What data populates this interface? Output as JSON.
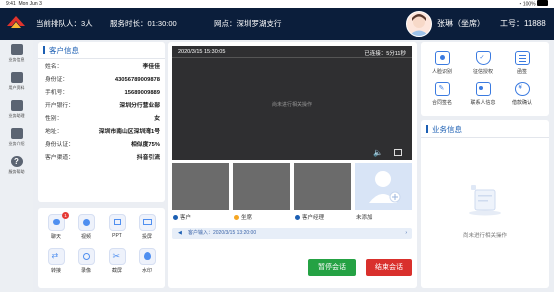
{
  "status_bar": {
    "time": "9:41",
    "date": "Mon Jun 3",
    "battery": "100%"
  },
  "top_bar": {
    "queue": "当前排队人：3人",
    "duration": "服务时长：01:30:00",
    "branch": "网点：深圳罗湖支行",
    "agent_name": "张琳（坐席）",
    "employee_id": "工号：11888"
  },
  "sidebar": {
    "items": [
      {
        "label": "业务信息",
        "icon": "grid-icon"
      },
      {
        "label": "用户资料",
        "icon": "book-icon"
      },
      {
        "label": "业务助理",
        "icon": "assistant-icon"
      },
      {
        "label": "业务介绍",
        "icon": "briefcase-icon"
      },
      {
        "label": "服务帮助",
        "icon": "help-icon"
      }
    ]
  },
  "customer": {
    "title": "客户信息",
    "rows": [
      {
        "key": "姓名：",
        "value": "李佳佳"
      },
      {
        "key": "身份证：",
        "value": "43056789009878"
      },
      {
        "key": "手机号：",
        "value": "15689009889"
      },
      {
        "key": "开户银行：",
        "value": "深圳分行营业部"
      },
      {
        "key": "性别：",
        "value": "女"
      },
      {
        "key": "地址：",
        "value": "深圳市南山区深圳湾1号"
      },
      {
        "key": "身份认证：",
        "value": "相似度75%"
      },
      {
        "key": "客户渠道：",
        "value": "抖音引流"
      }
    ]
  },
  "tools": [
    {
      "label": "聊天",
      "icon": "chat-icon",
      "badge": "1"
    },
    {
      "label": "视频",
      "icon": "video-icon"
    },
    {
      "label": "PPT",
      "icon": "ppt-icon"
    },
    {
      "label": "投屏",
      "icon": "screen-cast-icon"
    },
    {
      "label": "转接",
      "icon": "transfer-icon"
    },
    {
      "label": "录像",
      "icon": "record-icon"
    },
    {
      "label": "截屏",
      "icon": "screenshot-icon"
    },
    {
      "label": "水印",
      "icon": "watermark-icon"
    }
  ],
  "video": {
    "datetime": "2020/3/15  15:30:05",
    "connected": "已连接：5分11秒",
    "placeholder": "尚未进行相关操作"
  },
  "participants": [
    {
      "label": "客户",
      "color": "#1c5fb3"
    },
    {
      "label": "坐席",
      "color": "#f5a623"
    },
    {
      "label": "客户经理",
      "color": "#1c5fb3"
    },
    {
      "label": "未添加",
      "color": ""
    }
  ],
  "message": {
    "text": "客户输入：2020/3/15 13:20:00"
  },
  "actions": {
    "pause": "暂停会话",
    "end": "结束会话"
  },
  "biz_tools": [
    {
      "label": "人脸识别",
      "icon": "face-id-icon"
    },
    {
      "label": "征信授权",
      "icon": "credit-shield-icon"
    },
    {
      "label": "函签",
      "icon": "document-icon"
    },
    {
      "label": "合同签名",
      "icon": "contract-sign-icon"
    },
    {
      "label": "联系人信息",
      "icon": "contact-card-icon"
    },
    {
      "label": "借款确认",
      "icon": "loan-confirm-icon"
    }
  ],
  "business": {
    "title": "业务信息",
    "placeholder": "尚未进行相关操作"
  }
}
